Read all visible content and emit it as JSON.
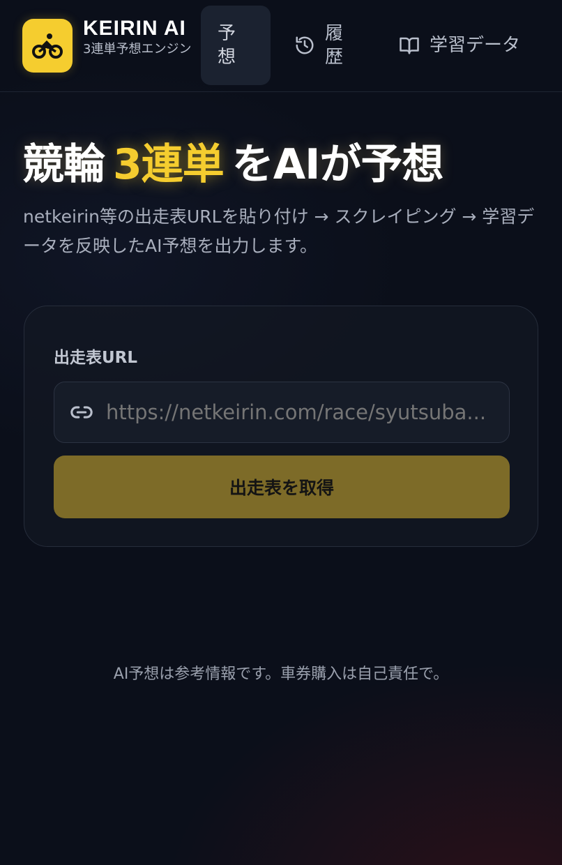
{
  "brand": {
    "title": "KEIRIN AI",
    "subtitle": "3連単予想エンジン",
    "logo_icon": "bicycle-icon",
    "accent_color": "#f5cd2f"
  },
  "nav": {
    "items": [
      {
        "label": "予想",
        "active": true
      },
      {
        "label": "履歴",
        "icon": "history-icon",
        "active": false
      },
      {
        "label": "学習データ",
        "icon": "book-open-icon",
        "active": false
      }
    ]
  },
  "hero": {
    "title_pre": "競輪",
    "title_accent": "3連単",
    "title_post": "をAIが予想",
    "description": "netkeirin等の出走表URLを貼り付け → スクレイピング → 学習データを反映したAI予想を出力します。"
  },
  "form": {
    "label": "出走表URL",
    "url_placeholder": "https://netkeirin.com/race/syutsuba...",
    "input_icon": "link-icon",
    "submit_label": "出走表を取得"
  },
  "footer": {
    "disclaimer": "AI予想は参考情報です。車券購入は自己責任で。"
  }
}
